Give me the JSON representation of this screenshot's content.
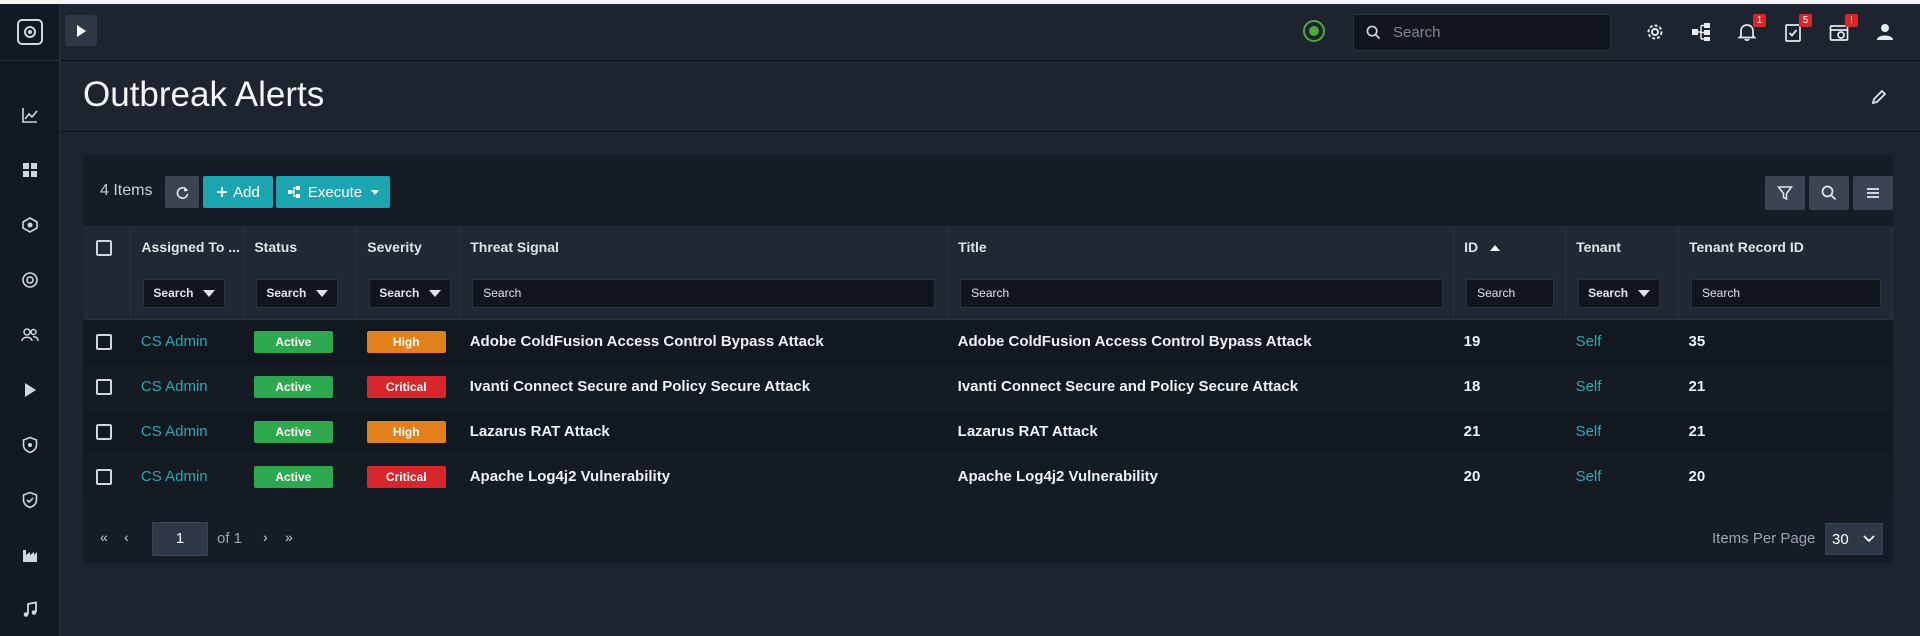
{
  "sidebar": {
    "icons": [
      "chart-line-icon",
      "dashboard-grid-icon",
      "incident-icon",
      "lifebuoy-icon",
      "users-icon",
      "play-icon",
      "shield-icon",
      "shield-check-icon",
      "factory-icon",
      "music-note-icon"
    ]
  },
  "topbar": {
    "search_placeholder": "Search",
    "notifications_count": "1",
    "tasks_count": "5",
    "system_alert": "!"
  },
  "page": {
    "title": "Outbreak Alerts"
  },
  "toolbar": {
    "count_label": "4 Items",
    "add_label": "Add",
    "execute_label": "Execute"
  },
  "table": {
    "columns": [
      "Assigned To ...",
      "Status",
      "Severity",
      "Threat Signal",
      "Title",
      "ID",
      "Tenant",
      "Tenant Record ID"
    ],
    "filter_placeholder": "Search",
    "sort_column": "ID",
    "rows": [
      {
        "assigned_to": "CS Admin",
        "status": "Active",
        "severity": "High",
        "threat_signal": "Adobe ColdFusion Access Control Bypass Attack",
        "title": "Adobe ColdFusion Access Control Bypass Attack",
        "id": "19",
        "tenant": "Self",
        "tenant_record_id": "35"
      },
      {
        "assigned_to": "CS Admin",
        "status": "Active",
        "severity": "Critical",
        "threat_signal": "Ivanti Connect Secure and Policy Secure Attack",
        "title": "Ivanti Connect Secure and Policy Secure Attack",
        "id": "18",
        "tenant": "Self",
        "tenant_record_id": "21"
      },
      {
        "assigned_to": "CS Admin",
        "status": "Active",
        "severity": "High",
        "threat_signal": "Lazarus RAT Attack",
        "title": "Lazarus RAT Attack",
        "id": "21",
        "tenant": "Self",
        "tenant_record_id": "21"
      },
      {
        "assigned_to": "CS Admin",
        "status": "Active",
        "severity": "Critical",
        "threat_signal": "Apache Log4j2 Vulnerability",
        "title": "Apache Log4j2 Vulnerability",
        "id": "20",
        "tenant": "Self",
        "tenant_record_id": "20"
      }
    ]
  },
  "pagination": {
    "current_page": "1",
    "of_label": "of 1",
    "items_per_page_label": "Items Per Page",
    "items_per_page_value": "30"
  },
  "colors": {
    "accent": "#1ba5b0",
    "active": "#2ea84e",
    "high": "#e2801c",
    "critical": "#d9262b",
    "link": "#26a9b8"
  }
}
